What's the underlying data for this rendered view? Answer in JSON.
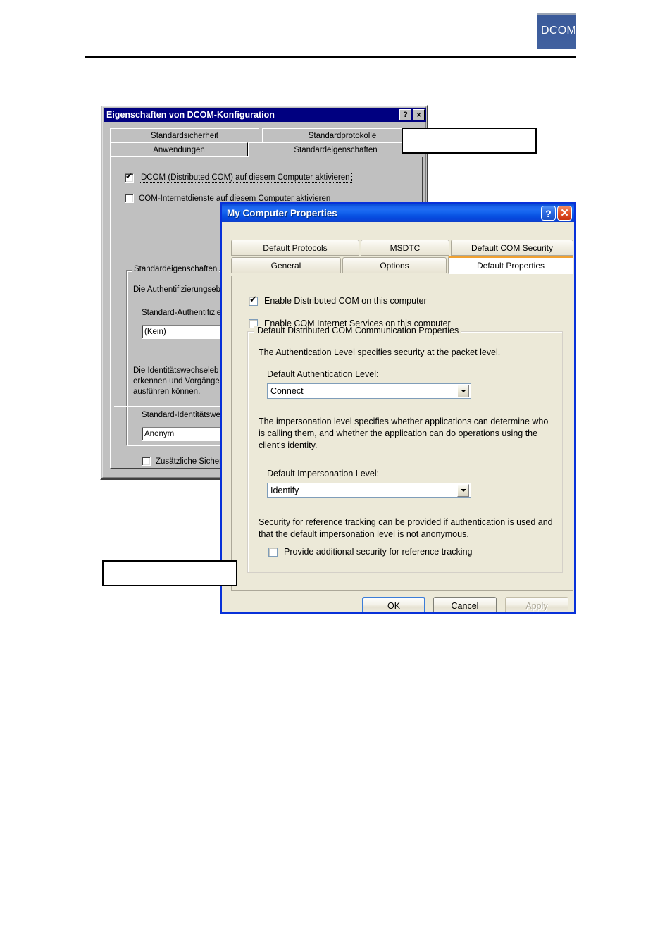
{
  "page": {
    "logo_text": "DCOM-"
  },
  "callouts": [
    {
      "name": "callout-top",
      "text": ""
    },
    {
      "name": "callout-bottom",
      "text": ""
    }
  ],
  "win2k_dialog": {
    "title": "Eigenschaften von DCOM-Konfiguration",
    "titlebar_buttons": {
      "help": "?",
      "close": "✕"
    },
    "tabs_row1": [
      {
        "label": "Standardsicherheit",
        "selected": false
      },
      {
        "label": "Standardprotokolle",
        "selected": false
      }
    ],
    "tabs_row2": [
      {
        "label": "Anwendungen",
        "selected": false
      },
      {
        "label": "Standardeigenschaften",
        "selected": true
      }
    ],
    "checkbox_dcom": {
      "label": "DCOM (Distributed COM) auf diesem Computer aktivieren",
      "checked": true
    },
    "checkbox_cis": {
      "label": "COM-Internetdienste auf diesem Computer aktivieren",
      "checked": false
    },
    "group_legend": "Standardeigenschaften",
    "auth_description": "Die Authentifizierungseb",
    "auth_label": "Standard-Authentifizier",
    "auth_value": "(Kein)",
    "impersonation_description_line1": "Die Identitätswechseleb",
    "impersonation_description_line2": "erkennen und Vorgänge",
    "impersonation_description_line3": "ausführen können.",
    "impersonation_label": "Standard-Identitätswe",
    "impersonation_value": "Anonym",
    "checkbox_extra": {
      "label": "Zusätzliche Sicherh",
      "checked": false
    }
  },
  "xp_dialog": {
    "title": "My Computer Properties",
    "titlebar_buttons": {
      "help": "?",
      "close": "✕"
    },
    "tabs_row1": [
      {
        "label": "Default Protocols",
        "selected": false
      },
      {
        "label": "MSDTC",
        "selected": false
      },
      {
        "label": "Default COM Security",
        "selected": false
      }
    ],
    "tabs_row2": [
      {
        "label": "General",
        "selected": false
      },
      {
        "label": "Options",
        "selected": false
      },
      {
        "label": "Default Properties",
        "selected": true
      }
    ],
    "checkbox_dcom": {
      "label": "Enable Distributed COM on this computer",
      "checked": true
    },
    "checkbox_cis": {
      "label": "Enable COM Internet Services on this computer",
      "checked": false
    },
    "group_legend": "Default Distributed COM Communication Properties",
    "auth_description": "The Authentication Level specifies security at the packet level.",
    "auth_label": "Default Authentication Level:",
    "auth_value": "Connect",
    "impersonation_description": "The impersonation level specifies whether applications can determine who is calling them, and whether the application can do operations using the client's identity.",
    "impersonation_label": "Default Impersonation Level:",
    "impersonation_value": "Identify",
    "reference_description": "Security for reference tracking can be provided if authentication is used and that the default impersonation level is not anonymous.",
    "checkbox_reference": {
      "label": "Provide additional security for reference tracking",
      "checked": false
    },
    "buttons": {
      "ok": "OK",
      "cancel": "Cancel",
      "apply": "Apply"
    }
  },
  "colors": {
    "xp_title_blue": "#0a4fd4",
    "xp_border_blue": "#0831d9",
    "xp_face": "#ece9d8",
    "xp_tab_orange": "#f0a030",
    "win2k_title_blue": "#000080",
    "win2k_face": "#c0c0c0",
    "logo_blue": "#3a5a99"
  }
}
